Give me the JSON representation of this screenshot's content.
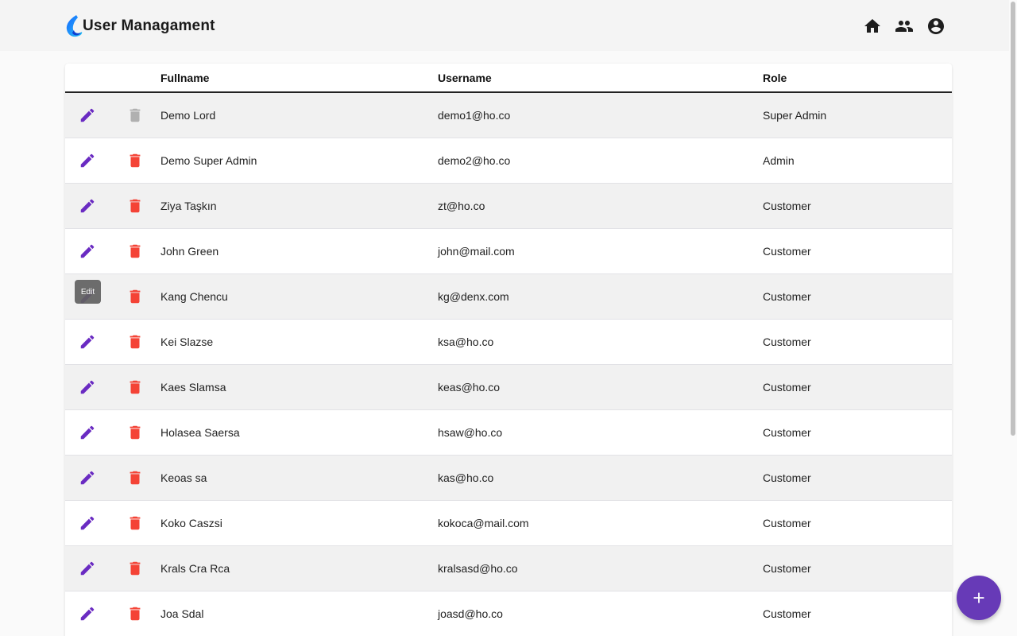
{
  "app": {
    "title": "User Managament"
  },
  "nav": {
    "home_icon": "home-icon",
    "users_icon": "people-icon",
    "account_icon": "account-circle-icon"
  },
  "table": {
    "headers": {
      "fullname": "Fullname",
      "username": "Username",
      "role": "Role"
    },
    "rows": [
      {
        "fullname": "Demo Lord",
        "username": "demo1@ho.co",
        "role": "Super Admin",
        "delete_disabled": true
      },
      {
        "fullname": "Demo Super Admin",
        "username": "demo2@ho.co",
        "role": "Admin",
        "delete_disabled": false
      },
      {
        "fullname": "Ziya Taşkın",
        "username": "zt@ho.co",
        "role": "Customer",
        "delete_disabled": false
      },
      {
        "fullname": "John Green",
        "username": "john@mail.com",
        "role": "Customer",
        "delete_disabled": false
      },
      {
        "fullname": "Kang Chencu",
        "username": "kg@denx.com",
        "role": "Customer",
        "delete_disabled": false
      },
      {
        "fullname": "Kei Slazse",
        "username": "ksa@ho.co",
        "role": "Customer",
        "delete_disabled": false
      },
      {
        "fullname": "Kaes Slamsa",
        "username": "keas@ho.co",
        "role": "Customer",
        "delete_disabled": false
      },
      {
        "fullname": "Holasea Saersa",
        "username": "hsaw@ho.co",
        "role": "Customer",
        "delete_disabled": false
      },
      {
        "fullname": "Keoas sa",
        "username": "kas@ho.co",
        "role": "Customer",
        "delete_disabled": false
      },
      {
        "fullname": "Koko Caszsi",
        "username": "kokoca@mail.com",
        "role": "Customer",
        "delete_disabled": false
      },
      {
        "fullname": "Krals Cra Rca",
        "username": "kralsasd@ho.co",
        "role": "Customer",
        "delete_disabled": false
      },
      {
        "fullname": "Joa Sdal",
        "username": "joasd@ho.co",
        "role": "Customer",
        "delete_disabled": false
      }
    ]
  },
  "tooltip": {
    "text": "Edit"
  },
  "fab": {
    "label": "add-user",
    "icon": "plus-icon"
  },
  "colors": {
    "accent": "#673ab7",
    "edit": "#6a2bc2",
    "delete": "#f44336",
    "delete_disabled": "#b0b0b0"
  }
}
